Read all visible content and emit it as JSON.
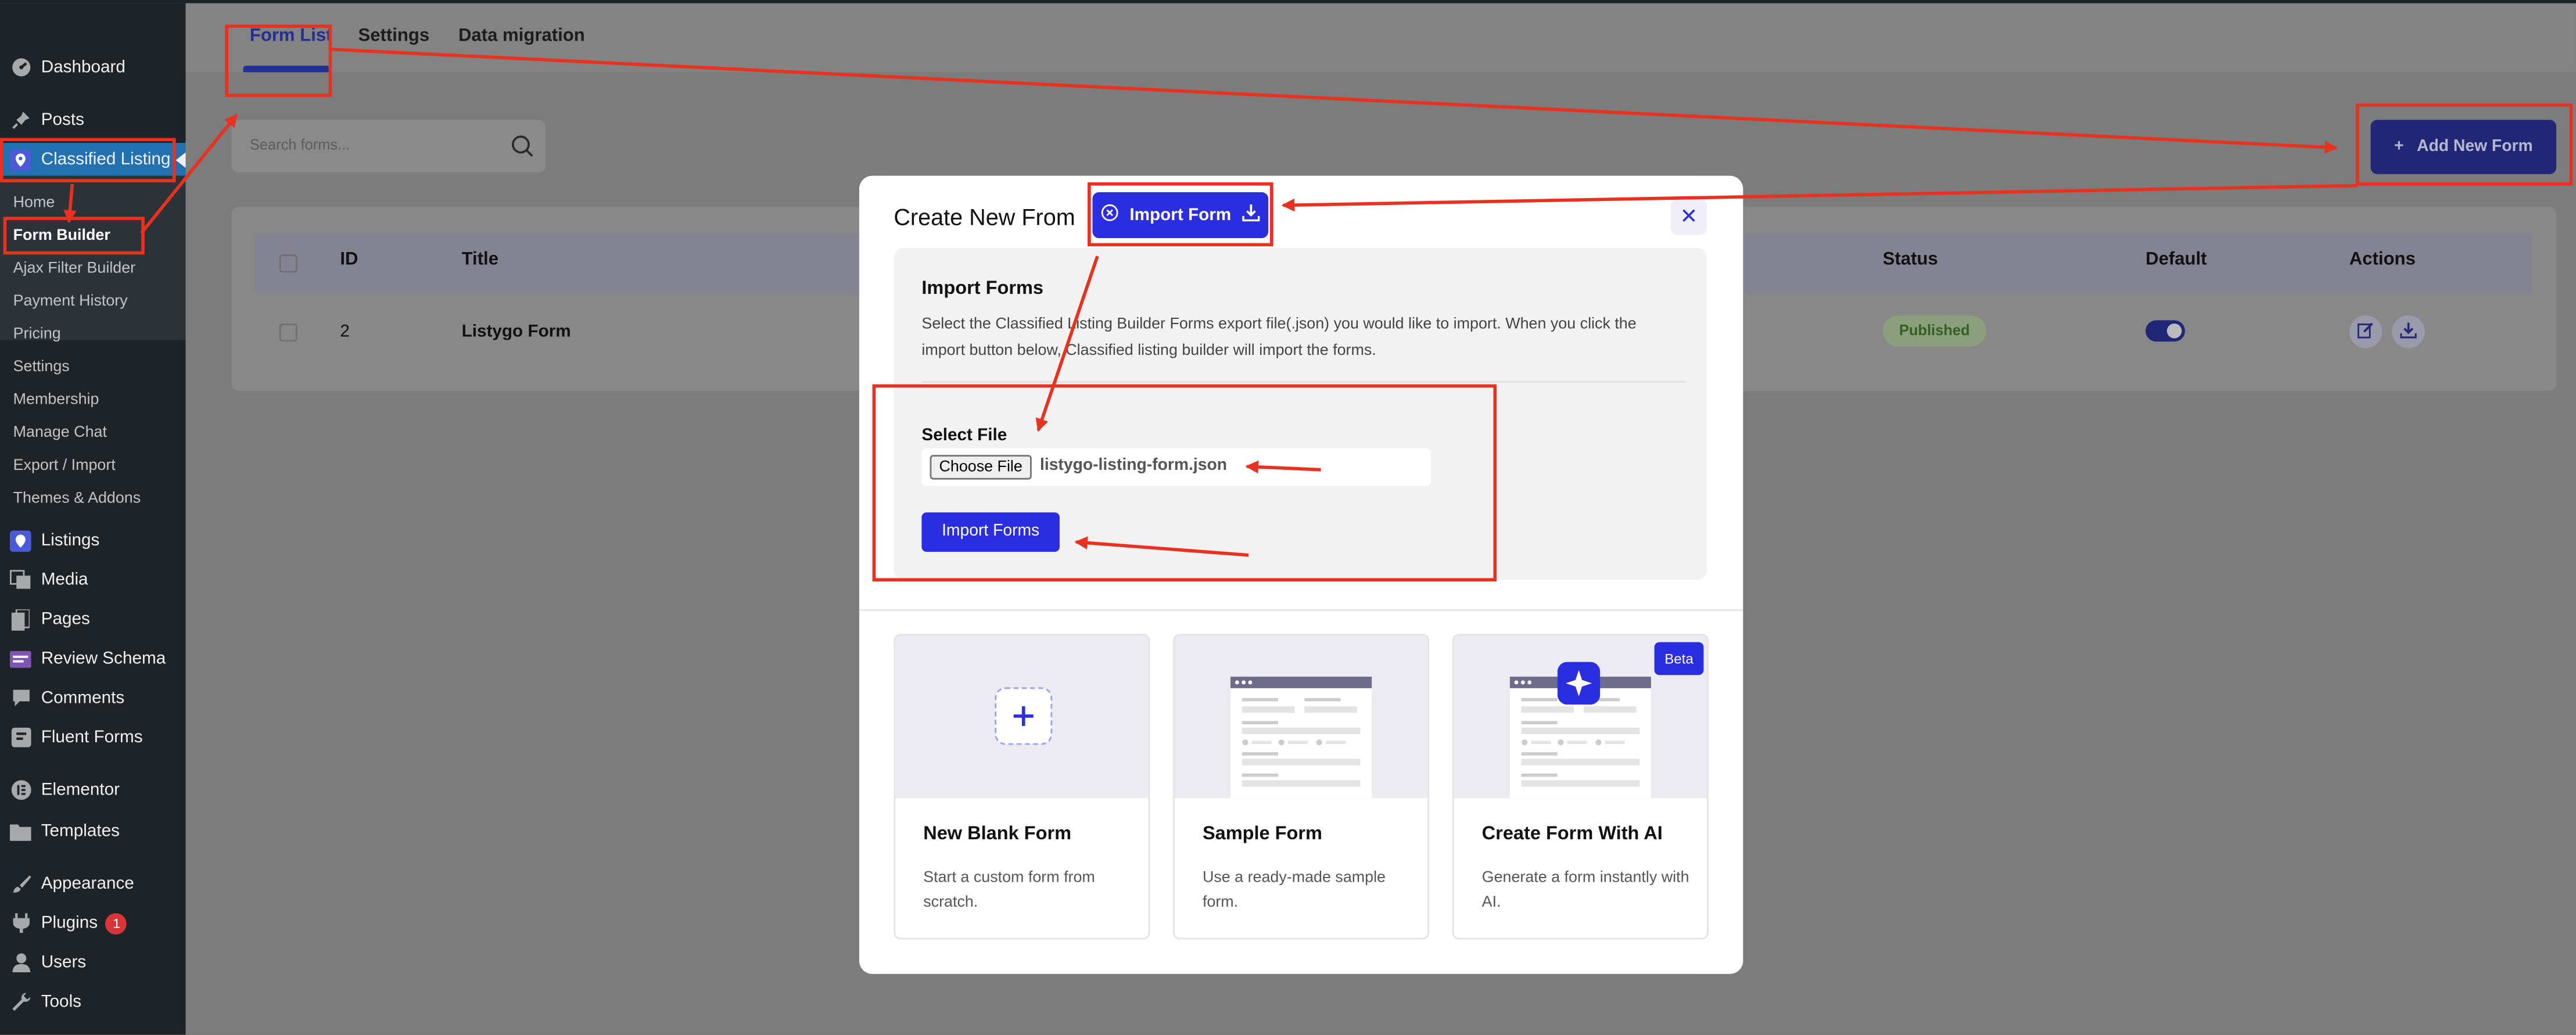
{
  "sidebar": {
    "items": [
      {
        "label": "Dashboard",
        "icon": "dashboard-icon"
      },
      {
        "label": "Posts",
        "icon": "pin-icon"
      },
      {
        "label": "Classified Listing",
        "icon": "listing-pin-icon"
      },
      {
        "label": "Listings",
        "icon": "listing-pin-icon"
      },
      {
        "label": "Media",
        "icon": "media-icon"
      },
      {
        "label": "Pages",
        "icon": "pages-icon"
      },
      {
        "label": "Review Schema",
        "icon": "review-icon"
      },
      {
        "label": "Comments",
        "icon": "comment-icon"
      },
      {
        "label": "Fluent Forms",
        "icon": "forms-icon"
      },
      {
        "label": "Elementor",
        "icon": "elementor-icon"
      },
      {
        "label": "Templates",
        "icon": "folder-icon"
      },
      {
        "label": "Appearance",
        "icon": "brush-icon"
      },
      {
        "label": "Plugins",
        "icon": "plugin-icon",
        "badge": "1"
      },
      {
        "label": "Users",
        "icon": "user-icon"
      },
      {
        "label": "Tools",
        "icon": "wrench-icon"
      }
    ],
    "submenu": [
      "Home",
      "Form Builder",
      "Ajax Filter Builder",
      "Payment History",
      "Pricing",
      "Settings",
      "Membership",
      "Manage Chat",
      "Export / Import",
      "Themes & Addons"
    ]
  },
  "tabs": [
    "Form List",
    "Settings",
    "Data migration"
  ],
  "search": {
    "placeholder": "Search forms..."
  },
  "add_button": "Add New Form",
  "table": {
    "headers": [
      "ID",
      "Title",
      "Status",
      "Default",
      "Actions"
    ],
    "rows": [
      {
        "id": "2",
        "title": "Listygo Form",
        "status": "Published"
      }
    ]
  },
  "modal": {
    "title": "Create New From",
    "import_button": "Import Form",
    "close": "✕",
    "import_section": {
      "heading": "Import Forms",
      "description": "Select the Classified Listing Builder Forms export file(.json) you would like to import. When you click the import button below, Classified listing builder will import the forms.",
      "select_label": "Select File",
      "choose_label": "Choose File",
      "file_name": "listygo-listing-form.json",
      "submit": "Import Forms"
    },
    "options": [
      {
        "title": "New Blank Form",
        "desc": "Start a custom form from scratch."
      },
      {
        "title": "Sample Form",
        "desc": "Use a ready-made sample form."
      },
      {
        "title": "Create Form With AI",
        "desc": "Generate a form instantly with AI.",
        "badge": "Beta"
      }
    ]
  },
  "colors": {
    "accent": "#2b2de0",
    "annotation": "#e8321f",
    "sidebar_bg": "#1d2327"
  }
}
